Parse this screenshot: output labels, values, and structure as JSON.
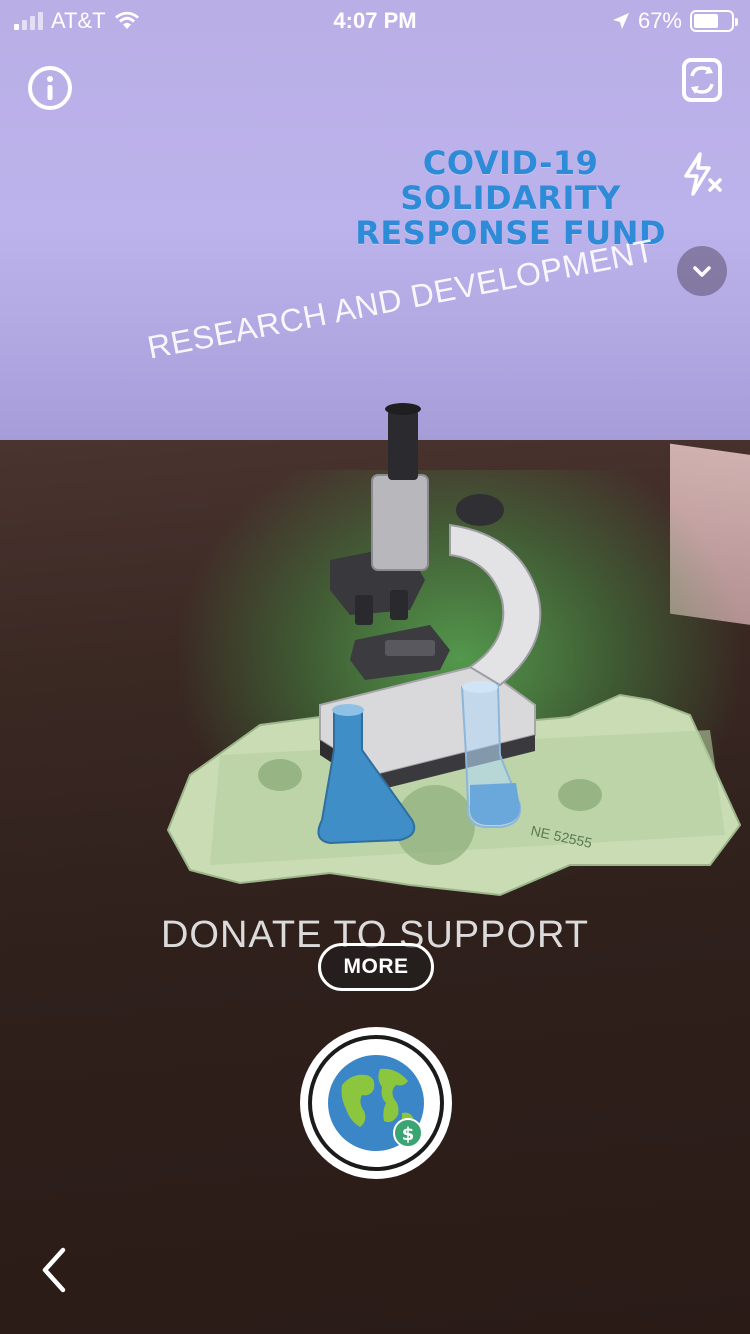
{
  "status_bar": {
    "carrier": "AT&T",
    "time": "4:07 PM",
    "battery_percent": "67%",
    "battery_level": 0.67,
    "icons": [
      "signal-bars-icon",
      "wifi-icon",
      "location-arrow-icon",
      "battery-icon"
    ]
  },
  "lens": {
    "fund_title_lines": [
      "COVID-19",
      "SOLIDARITY",
      "RESPONSE FUND"
    ],
    "category_label": "RESEARCH AND DEVELOPMENT",
    "donate_label": "DONATE TO SUPPORT",
    "more_button": "MORE"
  },
  "controls": {
    "icons": [
      "info-icon",
      "camera-flip-icon",
      "flash-off-icon",
      "chevron-down-icon",
      "globe-donate-icon",
      "back-chevron-icon"
    ]
  },
  "colors": {
    "fund_title": "#2e8bd8",
    "wall": "#b9aee6",
    "glow": "#5cbe5a"
  }
}
